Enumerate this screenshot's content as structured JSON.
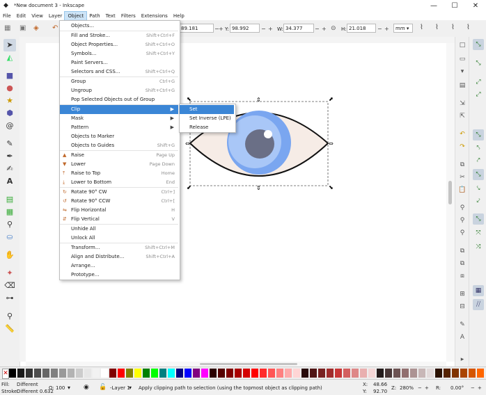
{
  "window": {
    "title": "*New document 3 - Inkscape",
    "minimize": "—",
    "maximize": "☐",
    "close": "✕"
  },
  "menubar": [
    "File",
    "Edit",
    "View",
    "Layer",
    "Object",
    "Path",
    "Text",
    "Filters",
    "Extensions",
    "Help"
  ],
  "toolctrl": {
    "x_value": "89.181",
    "y_label": "Y:",
    "y_value": "98.992",
    "w_label": "W:",
    "w_value": "34.377",
    "h_label": "H:",
    "h_value": "21.018",
    "unit": "mm"
  },
  "object_menu": [
    {
      "label": "Objects...",
      "shortcut": ""
    },
    {
      "label": "Fill and Stroke...",
      "shortcut": "Shift+Ctrl+F"
    },
    {
      "label": "Object Properties...",
      "shortcut": "Shift+Ctrl+O"
    },
    {
      "label": "Symbols...",
      "shortcut": "Shift+Ctrl+Y"
    },
    {
      "label": "Paint Servers...",
      "shortcut": ""
    },
    {
      "label": "Selectors and CSS...",
      "shortcut": "Shift+Ctrl+Q"
    },
    {
      "label": "Group",
      "shortcut": "Ctrl+G"
    },
    {
      "label": "Ungroup",
      "shortcut": "Shift+Ctrl+G"
    },
    {
      "label": "Pop Selected Objects out of Group",
      "shortcut": ""
    },
    {
      "label": "Clip",
      "shortcut": ""
    },
    {
      "label": "Mask",
      "shortcut": ""
    },
    {
      "label": "Pattern",
      "shortcut": ""
    },
    {
      "label": "Objects to Marker",
      "shortcut": ""
    },
    {
      "label": "Objects to Guides",
      "shortcut": "Shift+G"
    },
    {
      "label": "Raise",
      "shortcut": "Page Up"
    },
    {
      "label": "Lower",
      "shortcut": "Page Down"
    },
    {
      "label": "Raise to Top",
      "shortcut": "Home"
    },
    {
      "label": "Lower to Bottom",
      "shortcut": "End"
    },
    {
      "label": "Rotate 90° CW",
      "shortcut": "Ctrl+]"
    },
    {
      "label": "Rotate 90° CCW",
      "shortcut": "Ctrl+["
    },
    {
      "label": "Flip Horizontal",
      "shortcut": "H"
    },
    {
      "label": "Flip Vertical",
      "shortcut": "V"
    },
    {
      "label": "Unhide All",
      "shortcut": ""
    },
    {
      "label": "Unlock All",
      "shortcut": ""
    },
    {
      "label": "Transform...",
      "shortcut": "Shift+Ctrl+M"
    },
    {
      "label": "Align and Distribute...",
      "shortcut": "Shift+Ctrl+A"
    },
    {
      "label": "Arrange...",
      "shortcut": ""
    },
    {
      "label": "Prototype...",
      "shortcut": ""
    }
  ],
  "clip_submenu": [
    "Set",
    "Set Inverse (LPE)",
    "Release"
  ],
  "status": {
    "fill_label": "Fill:",
    "fill_value": "Different",
    "stroke_label": "Stroke:",
    "stroke_value": "Different 0.632",
    "opacity_label": "O:",
    "opacity_value": "100",
    "layer": "-Layer 1",
    "message": "Apply clipping path to selection (using the topmost object as clipping path)",
    "x_label": "X:",
    "x_value": "48.66",
    "y_label": "Y:",
    "y_value": "92.70",
    "zoom_label": "Z:",
    "zoom_value": "280%",
    "rotate_label": "R:",
    "rotate_value": "0.00°"
  },
  "colors": {
    "highlight": "#3b86d6",
    "iris_outer": "#7aa6f0",
    "iris_inner": "#a9c7f7",
    "pupil": "#6a6f86",
    "sclera": "#f6ece6"
  },
  "palette_colors": [
    "#000000",
    "#1a1a1a",
    "#333333",
    "#4d4d4d",
    "#666666",
    "#808080",
    "#999999",
    "#b3b3b3",
    "#cccccc",
    "#e6e6e6",
    "#f2f2f2",
    "#ffffff",
    "#800000",
    "#ff0000",
    "#808000",
    "#ffff00",
    "#008000",
    "#00ff00",
    "#008080",
    "#00ffff",
    "#000080",
    "#0000ff",
    "#800080",
    "#ff00ff",
    "#2b0000",
    "#550000",
    "#800000",
    "#aa0000",
    "#d40000",
    "#ff0000",
    "#ff2a2a",
    "#ff5555",
    "#ff8080",
    "#ffaaaa",
    "#ffd5d5",
    "#280b0b",
    "#501616",
    "#782121",
    "#a02c2c",
    "#c83737",
    "#d35f5f",
    "#de8787",
    "#e9afaf",
    "#f4d7d7",
    "#241c1c",
    "#483737",
    "#6c5353",
    "#916f6f",
    "#ac9393",
    "#c8b7b7",
    "#e3dbdb",
    "#2b1100",
    "#552200",
    "#803300",
    "#aa4400",
    "#d45500",
    "#ff6600"
  ]
}
